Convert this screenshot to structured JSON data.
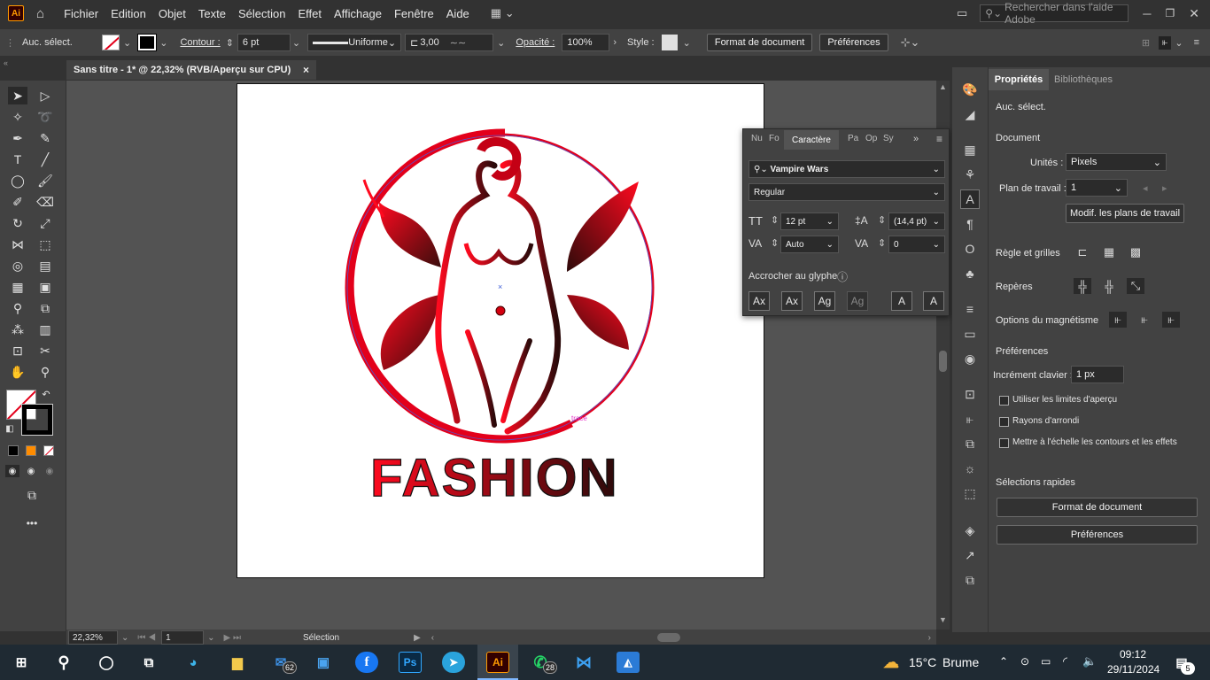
{
  "app": {
    "logo": "Ai",
    "menu": [
      "Fichier",
      "Edition",
      "Objet",
      "Texte",
      "Sélection",
      "Effet",
      "Affichage",
      "Fenêtre",
      "Aide"
    ],
    "search_placeholder": "Rechercher dans l'aide Adobe"
  },
  "control_bar": {
    "selection_label": "Auc. sélect.",
    "stroke_label": "Contour :",
    "stroke_value": "6 pt",
    "stroke_profile": "Uniforme",
    "brush_value": "3,00",
    "opacity_label": "Opacité :",
    "opacity_value": "100%",
    "style_label": "Style :",
    "doc_setup_button": "Format de document",
    "prefs_button": "Préférences"
  },
  "document_tab": {
    "title": "Sans titre - 1* @ 22,32% (RVB/Aperçu sur CPU)",
    "close": "×"
  },
  "artwork": {
    "logo_text": "FASHION",
    "smart_guide_label": "tracé"
  },
  "character_panel": {
    "tabs": [
      "Nu",
      "Fo",
      "Caractère",
      "Pa",
      "Op",
      "Sy"
    ],
    "active_tab": "Caractère",
    "font_family": "Vampire Wars",
    "font_style": "Regular",
    "font_size": "12 pt",
    "leading": "(14,4 pt)",
    "kerning": "Auto",
    "tracking": "0",
    "snap_label": "Accrocher au glyphe",
    "snap_buttons": [
      "Ax",
      "Ax",
      "Ag",
      "Ag",
      "A",
      "A"
    ]
  },
  "properties_panel": {
    "tabs": [
      "Propriétés",
      "Bibliothèques"
    ],
    "selection": "Auc. sélect.",
    "document_heading": "Document",
    "units_label": "Unités :",
    "units_value": "Pixels",
    "artboard_label": "Plan de travail :",
    "artboard_value": "1",
    "edit_artboards_button": "Modif. les plans de travail",
    "rulers_label": "Règle et grilles",
    "guides_label": "Repères",
    "snap_label": "Options du magnétisme",
    "prefs_heading": "Préférences",
    "keyboard_increment_label": "Incrément clavier :",
    "keyboard_increment_value": "1 px",
    "checkboxes": [
      "Utiliser les limites d'aperçu",
      "Rayons d'arrondi",
      "Mettre à l'échelle les contours et les effets"
    ],
    "quick_actions_heading": "Sélections rapides",
    "quick_doc_setup": "Format de document",
    "quick_prefs": "Préférences"
  },
  "status_bar": {
    "zoom": "22,32%",
    "artboard": "1",
    "tool": "Sélection"
  },
  "taskbar": {
    "weather_temp": "15°C",
    "weather_desc": "Brume",
    "time": "09:12",
    "date": "29/11/2024",
    "mail_badge": "62",
    "whatsapp_badge": "28",
    "notif_badge": "5",
    "ps_label": "Ps",
    "ai_label": "Ai"
  },
  "colors": {
    "accent_red": "#e3001b",
    "dark_red": "#3a0c0c",
    "ui_dark": "#323232",
    "ui_panel": "#424242",
    "canvas": "#535353"
  }
}
